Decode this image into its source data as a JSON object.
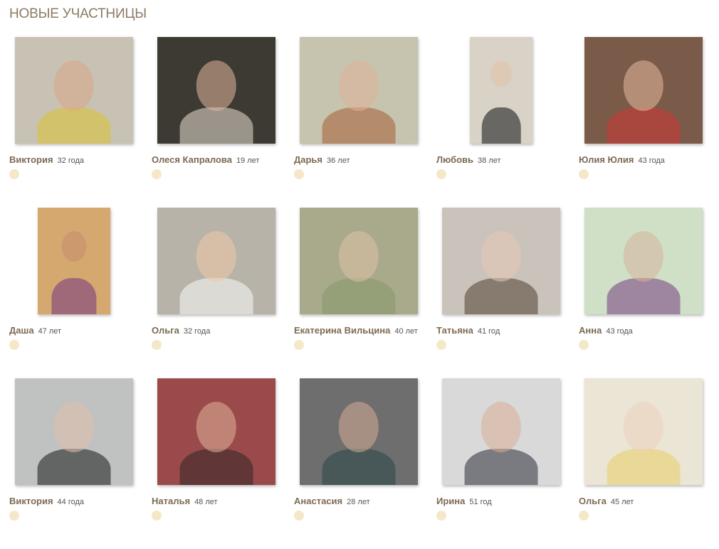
{
  "title": "НОВЫЕ УЧАСТНИЦЫ",
  "members": [
    {
      "name": "Виктория",
      "age": "32 года",
      "photo": {
        "w": 166,
        "bg": "#c8c2b4",
        "skin": "#d9a787",
        "cloth": "#d8c23a"
      }
    },
    {
      "name": "Олеся Капралова",
      "age": "19 лет",
      "photo": {
        "w": 166,
        "bg": "#3d3a33",
        "skin": "#e1b79a",
        "cloth": "#d8d0c4"
      }
    },
    {
      "name": "Дарья",
      "age": "36 лет",
      "photo": {
        "w": 166,
        "bg": "#c6c3ae",
        "skin": "#e2b39a",
        "cloth": "#a8673e"
      }
    },
    {
      "name": "Любовь",
      "age": "38 лет",
      "photo": {
        "w": 88,
        "bg": "#d8d2c7",
        "skin": "#e3c1a6",
        "cloth": "#1f1f22"
      }
    },
    {
      "name": "Юлия Юлия",
      "age": "43 года",
      "photo": {
        "w": 166,
        "bg": "#7a5a48",
        "skin": "#e4b99d",
        "cloth": "#c83b3b"
      }
    },
    {
      "name": "Даша",
      "age": "47 лет",
      "photo": {
        "w": 102,
        "bg": "#d5a870",
        "skin": "#c48d6f",
        "cloth": "#7d3f80"
      }
    },
    {
      "name": "Ольга",
      "age": "32 года",
      "photo": {
        "w": 166,
        "bg": "#b8b3a8",
        "skin": "#f0c9a6",
        "cloth": "#f4f4f4"
      }
    },
    {
      "name": "Екатерина Вильцина",
      "age": "40 лет",
      "photo": {
        "w": 166,
        "bg": "#a9aa8c",
        "skin": "#dfc0a6",
        "cloth": "#8a9a6a"
      }
    },
    {
      "name": "Татьяна",
      "age": "41 год",
      "photo": {
        "w": 166,
        "bg": "#c9c3bb",
        "skin": "#e5c8b6",
        "cloth": "#5c4a3a"
      }
    },
    {
      "name": "Анна",
      "age": "43 года",
      "photo": {
        "w": 166,
        "bg": "#cfe0c7",
        "skin": "#d9b39b",
        "cloth": "#7f4a85"
      }
    },
    {
      "name": "Виктория",
      "age": "44 года",
      "photo": {
        "w": 166,
        "bg": "#bfc2c0",
        "skin": "#e3c0ac",
        "cloth": "#262626"
      }
    },
    {
      "name": "Наталья",
      "age": "48 лет",
      "photo": {
        "w": 166,
        "bg": "#9a4a4a",
        "skin": "#dfb49b",
        "cloth": "#3a2a2a"
      }
    },
    {
      "name": "Анастасия",
      "age": "28 лет",
      "photo": {
        "w": 166,
        "bg": "#6e6e6e",
        "skin": "#d6ac95",
        "cloth": "#2f4a4a"
      }
    },
    {
      "name": "Ирина",
      "age": "51 год",
      "photo": {
        "w": 166,
        "bg": "#d9d9d9",
        "skin": "#d9ad96",
        "cloth": "#3a3c44"
      }
    },
    {
      "name": "Ольга",
      "age": "45 лет",
      "photo": {
        "w": 166,
        "bg": "#ebe5d6",
        "skin": "#ecd1bd",
        "cloth": "#e8d070"
      }
    }
  ]
}
